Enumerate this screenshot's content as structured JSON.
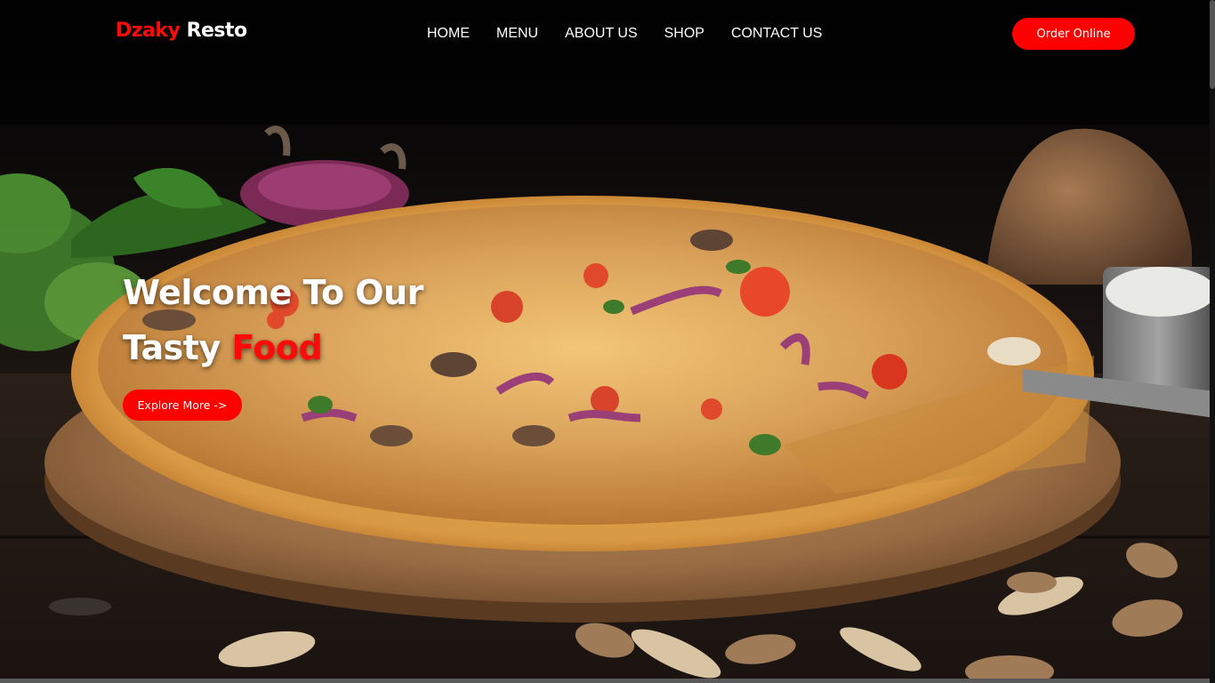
{
  "brand": {
    "part1": "Dzaky",
    "part2": "Resto"
  },
  "nav": {
    "items": [
      {
        "label": "HOME"
      },
      {
        "label": "MENU"
      },
      {
        "label": "ABOUT US"
      },
      {
        "label": "SHOP"
      },
      {
        "label": "CONTACT US"
      }
    ],
    "order_label": "Order Online"
  },
  "hero": {
    "line1": "Welcome To Our",
    "line2_plain": "Tasty",
    "line2_accent": "Food",
    "cta_label": "Explore More ->",
    "image_subject": "pizza-on-wooden-board"
  },
  "colors": {
    "accent": "#ff0000",
    "text": "#ffffff",
    "background": "#000000"
  }
}
